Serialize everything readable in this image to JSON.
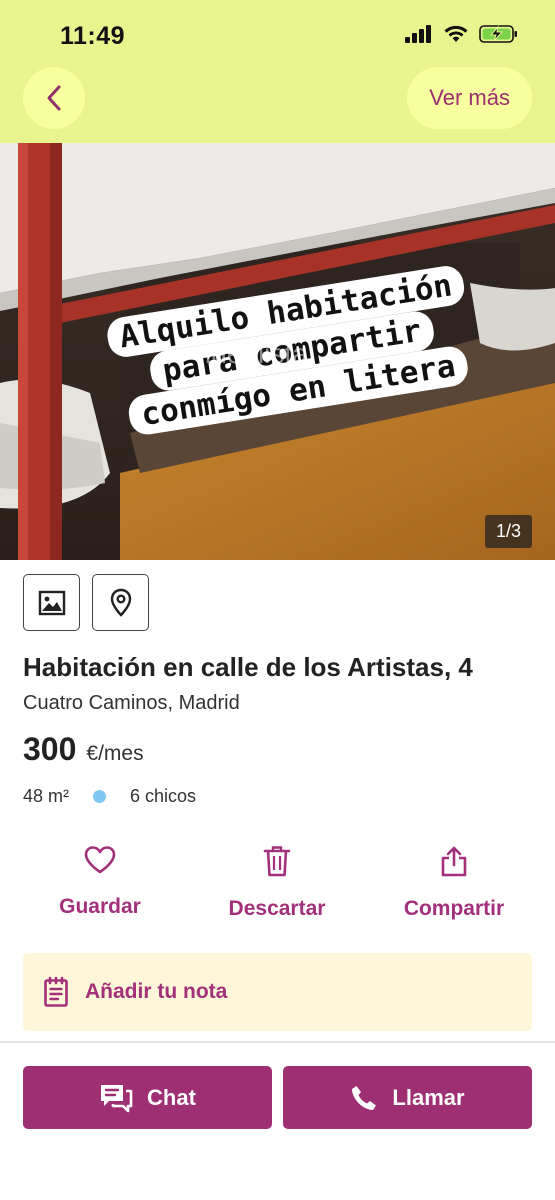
{
  "status_bar": {
    "time": "11:49"
  },
  "header": {
    "more_label": "Ver más"
  },
  "photo": {
    "overlay_lines": [
      "Alquilo habitación",
      "para compartir",
      "conmígo en litera"
    ],
    "watermark": "idealista",
    "counter": "1/3"
  },
  "listing": {
    "title": "Habitación en calle de los Artistas, 4",
    "location": "Cuatro Caminos, Madrid",
    "price": "300",
    "price_unit": "€/mes",
    "area": "48 m²",
    "occupants": "6 chicos"
  },
  "actions": {
    "save": "Guardar",
    "discard": "Descartar",
    "share": "Compartir"
  },
  "note": {
    "label": "Añadir tu nota"
  },
  "cta": {
    "chat": "Chat",
    "call": "Llamar"
  },
  "colors": {
    "header": "#e8f58e",
    "accent": "#a3307a",
    "cta": "#9e2f72",
    "note_bg": "#fdf6d8",
    "dot": "#7ec8f1"
  }
}
